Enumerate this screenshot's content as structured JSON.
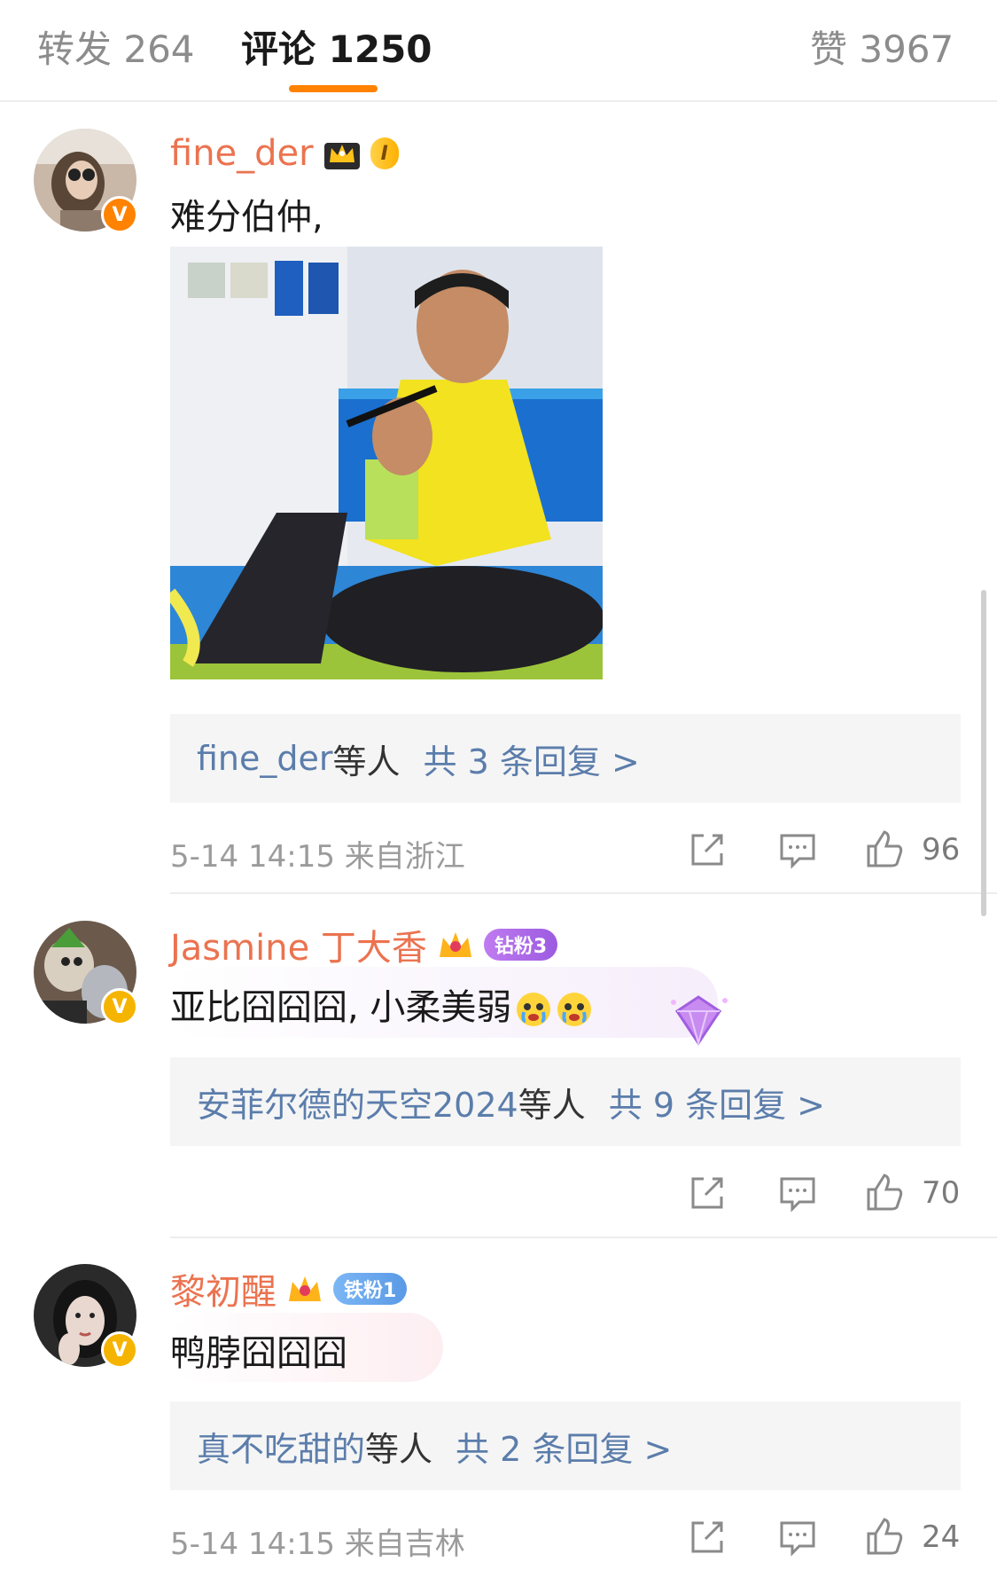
{
  "tabs": {
    "repost": "转发 264",
    "comments": "评论 1250",
    "likes": "赞 3967"
  },
  "icons": {
    "share": "share-icon",
    "comment": "comment-icon",
    "like": "thumbs-up-icon",
    "verified": "verified-v-icon",
    "crown": "crown-icon",
    "diamond": "diamond-icon"
  },
  "colors": {
    "accent": "#ff8200",
    "username": "#eb7350",
    "link": "#5b7dab",
    "meta": "#9b9b9b"
  },
  "comments": [
    {
      "username": "fine_der",
      "badge": "I",
      "text": "难分伯仲,",
      "replies": {
        "names": "fine_der",
        "mid": "等人",
        "count": "共 3 条回复 >"
      },
      "timestamp": "5-14 14:15  来自浙江",
      "likes": "96"
    },
    {
      "username": "Jasmine 丁大香",
      "badge": "钻粉3",
      "text": "亚比囧囧囧, 小柔美弱",
      "replies": {
        "names": "安菲尔德的天空2024",
        "mid": "等人",
        "count": "共 9 条回复 >"
      },
      "likes": "70"
    },
    {
      "username": "黎初醒",
      "badge": "铁粉1",
      "text": "鸭脖囧囧囧",
      "replies": {
        "names": "真不吃甜的",
        "mid": "等人",
        "count": "共 2 条回复 >"
      },
      "timestamp": "5-14 14:15  来自吉林",
      "likes": "24"
    }
  ]
}
